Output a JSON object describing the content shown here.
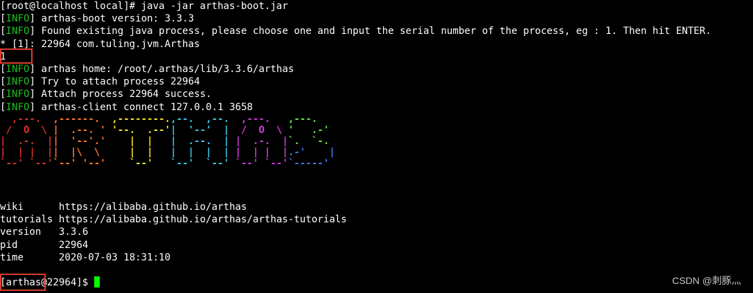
{
  "terminal": {
    "prompt_line": "[root@localhost local]# java -jar arthas-boot.jar",
    "info_tag": "INFO",
    "lines_1": [
      "arthas-boot version: 3.3.3",
      "Found existing java process, please choose one and input the serial number of the process, eg : 1. Then hit ENTER."
    ],
    "process_line": "* [1]: 22964 com.tuling.jvm.Arthas",
    "user_input": "1",
    "lines_2": [
      "arthas home: /root/.arthas/lib/3.3.6/arthas",
      "Try to attach process 22964",
      "Attach process 22964 success.",
      "arthas-client connect 127.0.0.1 3658"
    ],
    "banner_logo": "ARTHAS",
    "info_table": [
      {
        "key": "wiki",
        "value": "https://alibaba.github.io/arthas"
      },
      {
        "key": "tutorials",
        "value": "https://alibaba.github.io/arthas/arthas-tutorials"
      },
      {
        "key": "version",
        "value": "3.3.6"
      },
      {
        "key": "pid",
        "value": "22964"
      },
      {
        "key": "time",
        "value": "2020-07-03 18:31:10"
      }
    ],
    "final_prompt": "[arthas@22964]$ ",
    "watermark": "CSDN @刺豚灬"
  },
  "colors": {
    "background": "#000000",
    "text": "#ffffff",
    "info_tag": "#1fbf1f",
    "highlight_box": "#e03b2f",
    "cursor": "#00ff00"
  }
}
